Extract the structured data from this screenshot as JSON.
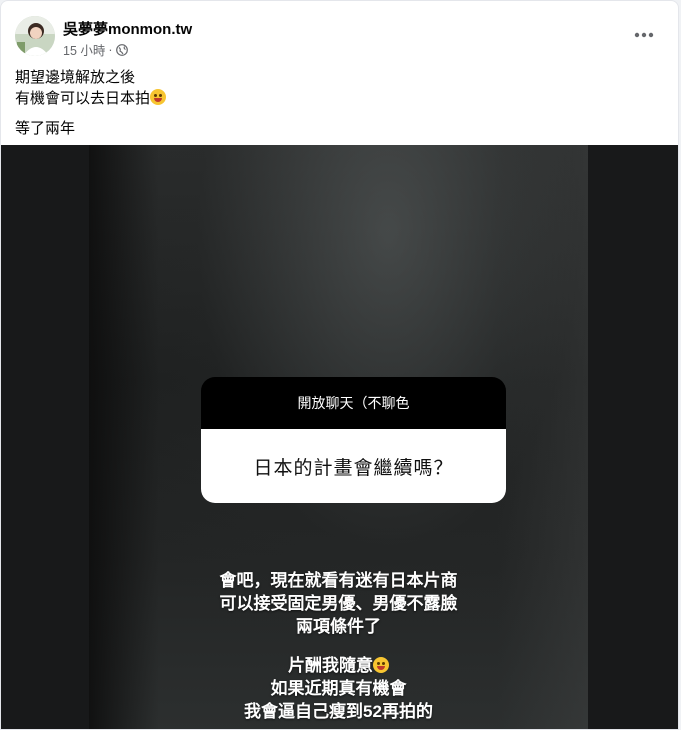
{
  "post": {
    "author": "吳夢夢monmon.tw",
    "time": "15 小時",
    "separator": "·",
    "privacy_icon": "globe-icon",
    "more_icon": "more-options-icon",
    "text_lines": [
      "期望邊境解放之後",
      "有機會可以去日本拍"
    ],
    "text_line_after_gap": "等了兩年",
    "emoji": "laughing-emoji"
  },
  "story": {
    "question_header": "開放聊天（不聊色",
    "question": "日本的計畫會繼續嗎？",
    "answer_lines": [
      "會吧，現在就看有迷有日本片商",
      "可以接受固定男優、男優不露臉",
      "兩項條件了"
    ],
    "answer_lines_2": [
      "片酬我隨意",
      "如果近期真有機會",
      "我會逼自己瘦到52再拍的"
    ]
  },
  "colors": {
    "text_primary": "#050505",
    "text_secondary": "#65676b",
    "story_bg": "#232525",
    "question_header_bg": "#000000"
  }
}
